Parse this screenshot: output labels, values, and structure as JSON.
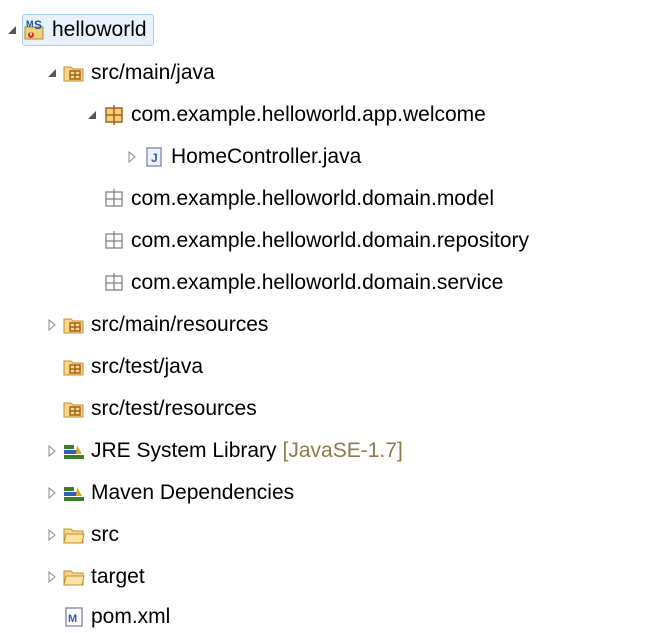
{
  "tree": {
    "items": [
      {
        "label": "helloworld",
        "icon": "maven-project-icon",
        "twisty": "expanded",
        "depth": 0,
        "selected": true
      },
      {
        "label": "src/main/java",
        "icon": "source-folder-icon",
        "twisty": "expanded",
        "depth": 1
      },
      {
        "label": "com.example.helloworld.app.welcome",
        "icon": "package-icon",
        "twisty": "expanded",
        "depth": 2
      },
      {
        "label": "HomeController.java",
        "icon": "java-file-icon",
        "twisty": "collapsed",
        "depth": 3
      },
      {
        "label": "com.example.helloworld.domain.model",
        "icon": "empty-package-icon",
        "twisty": "none",
        "depth": 2
      },
      {
        "label": "com.example.helloworld.domain.repository",
        "icon": "empty-package-icon",
        "twisty": "none",
        "depth": 2
      },
      {
        "label": "com.example.helloworld.domain.service",
        "icon": "empty-package-icon",
        "twisty": "none",
        "depth": 2
      },
      {
        "label": "src/main/resources",
        "icon": "source-folder-icon",
        "twisty": "collapsed",
        "depth": 1
      },
      {
        "label": "src/test/java",
        "icon": "source-folder-icon",
        "twisty": "none",
        "depth": 1
      },
      {
        "label": "src/test/resources",
        "icon": "source-folder-icon",
        "twisty": "none",
        "depth": 1
      },
      {
        "label": "JRE System Library",
        "decoration": "[JavaSE-1.7]",
        "icon": "library-icon",
        "twisty": "collapsed",
        "depth": 1
      },
      {
        "label": "Maven Dependencies",
        "icon": "library-icon",
        "twisty": "collapsed",
        "depth": 1
      },
      {
        "label": "src",
        "icon": "folder-icon",
        "twisty": "collapsed",
        "depth": 1
      },
      {
        "label": "target",
        "icon": "folder-icon",
        "twisty": "collapsed",
        "depth": 1
      },
      {
        "label": "pom.xml",
        "icon": "maven-pom-icon",
        "twisty": "none",
        "depth": 1
      }
    ]
  }
}
